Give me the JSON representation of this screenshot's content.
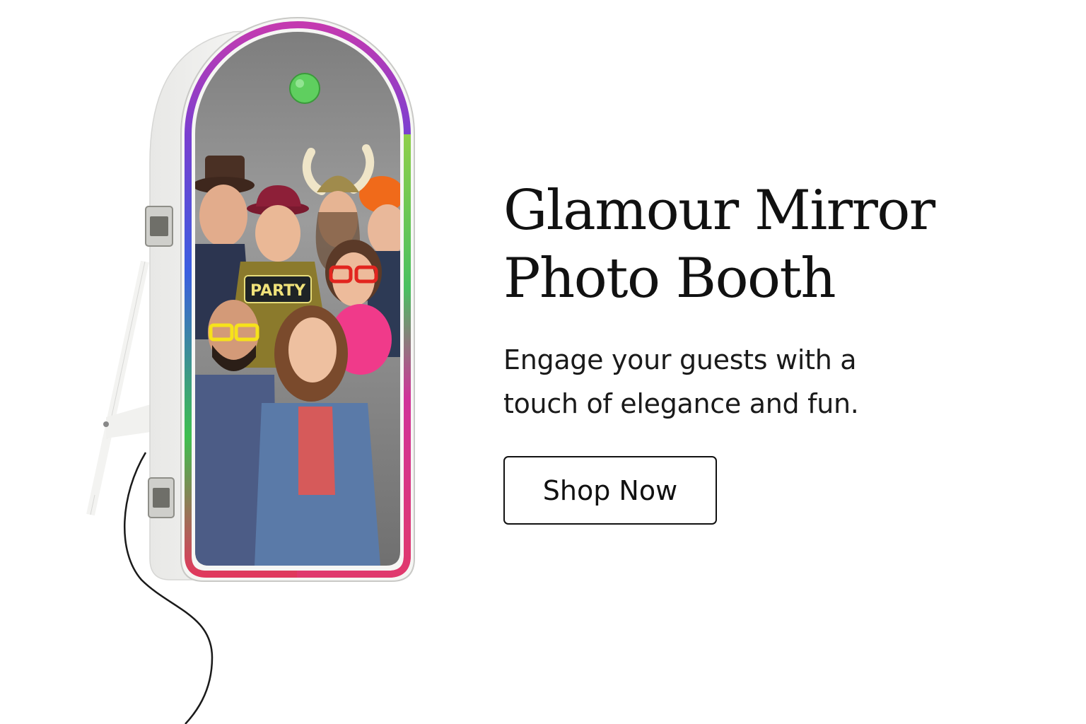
{
  "hero": {
    "headline_line1": "Glamour Mirror",
    "headline_line2": "Photo Booth",
    "subhead_line1": "Engage your guests with a",
    "subhead_line2": "touch of elegance and fun.",
    "cta_label": "Shop Now"
  },
  "product_photo": {
    "prop_sign_text": "PARTY",
    "colors": {
      "frame_white": "#f4f4f2",
      "screen_background": "#8f8f8f",
      "status_light": "#5fcf5f",
      "led_rim": [
        "#d0339a",
        "#3c63e0",
        "#3fc44f",
        "#e0395d"
      ]
    }
  }
}
